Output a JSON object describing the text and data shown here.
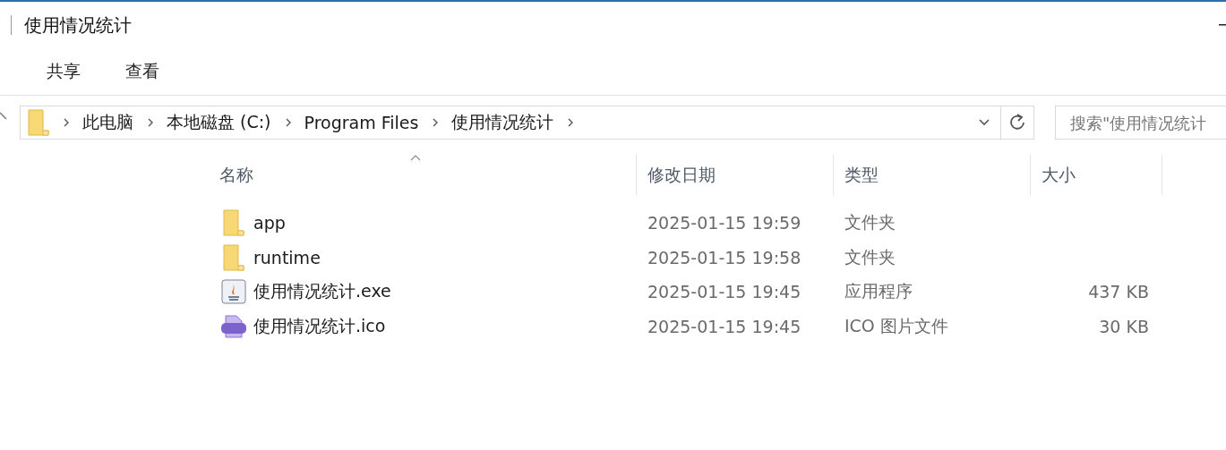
{
  "window": {
    "title": "使用情况统计"
  },
  "ribbon_tabs": [
    {
      "label": "共享"
    },
    {
      "label": "查看"
    }
  ],
  "address_bar": {
    "path": [
      "此电脑",
      "本地磁盘 (C:)",
      "Program Files",
      "使用情况统计"
    ]
  },
  "search": {
    "placeholder": "搜索\"使用情况统计"
  },
  "table": {
    "columns": [
      {
        "label": "名称",
        "sorted": true
      },
      {
        "label": "修改日期",
        "sorted": false
      },
      {
        "label": "类型",
        "sorted": false
      },
      {
        "label": "大小",
        "sorted": false
      }
    ],
    "rows": [
      {
        "kind": "folder",
        "name": "app",
        "modified": "2025-01-15 19:59",
        "type": "文件夹"
      },
      {
        "kind": "folder",
        "name": "runtime",
        "modified": "2025-01-15 19:58",
        "type": "文件夹"
      },
      {
        "kind": "exe",
        "name": "使用情况统计.exe",
        "modified": "2025-01-15 19:45",
        "type": "应用程序",
        "size": "437 KB"
      },
      {
        "kind": "ico",
        "name": "使用情况统计.ico",
        "modified": "2025-01-15 19:45",
        "type": "ICO 图片文件",
        "size": "30 KB"
      }
    ]
  }
}
